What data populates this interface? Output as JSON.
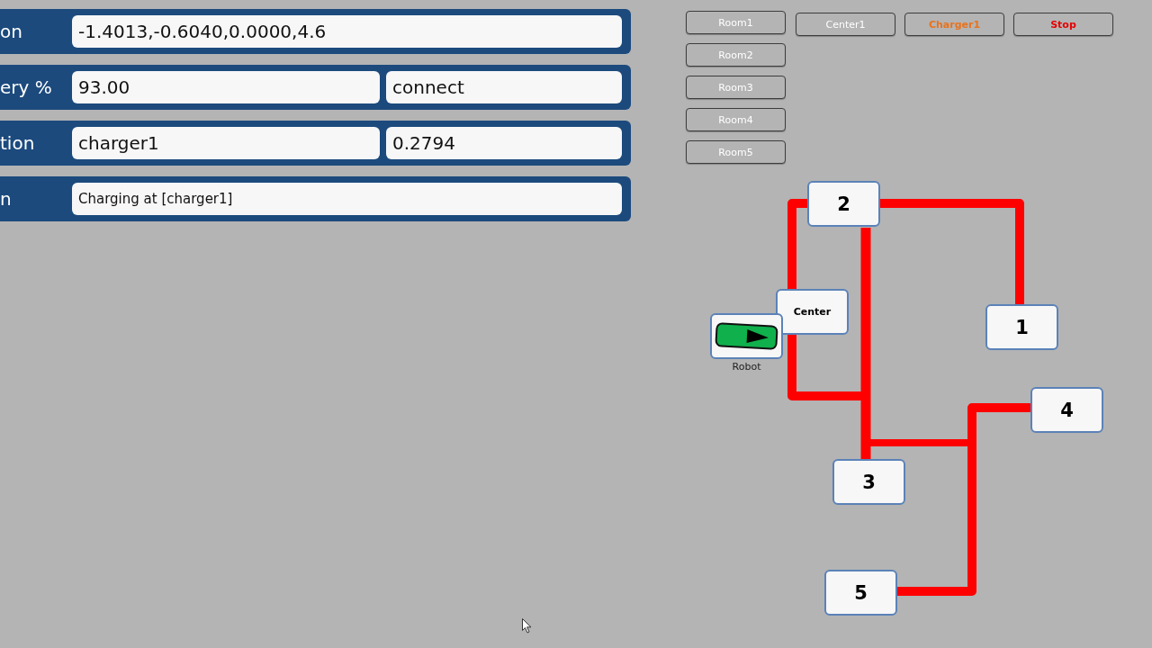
{
  "status_rows": [
    {
      "label": "on",
      "kind": "value",
      "fields": [
        "-1.4013,-0.6040,0.0000,4.6"
      ]
    },
    {
      "label": "ery %",
      "kind": "value",
      "fields": [
        "93.00",
        "connect"
      ]
    },
    {
      "label": "tion",
      "kind": "value",
      "fields": [
        "charger1",
        "0.2794"
      ]
    },
    {
      "label": "n",
      "kind": "message",
      "fields": [
        "Charging at [charger1]"
      ]
    }
  ],
  "room_buttons": [
    "Room1",
    "Room2",
    "Room3",
    "Room4",
    "Room5"
  ],
  "command_buttons": [
    {
      "label": "Center1",
      "kind": "location"
    },
    {
      "label": "Charger1",
      "kind": "charger"
    },
    {
      "label": "Stop",
      "kind": "stop"
    }
  ],
  "map": {
    "nodes": [
      {
        "label": "2",
        "kind": "room"
      },
      {
        "label": "Center",
        "kind": "center"
      },
      {
        "label": "1",
        "kind": "room"
      },
      {
        "label": "4",
        "kind": "room"
      },
      {
        "label": "3",
        "kind": "room"
      },
      {
        "label": "5",
        "kind": "room"
      }
    ],
    "robot": {
      "label": "Robot"
    }
  }
}
